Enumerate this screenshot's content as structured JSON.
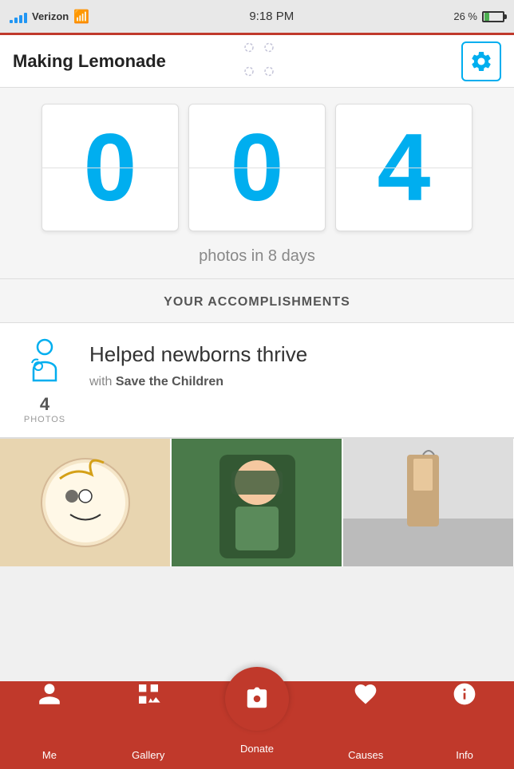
{
  "statusBar": {
    "carrier": "Verizon",
    "time": "9:18 PM",
    "battery": "26 %"
  },
  "header": {
    "title": "Making Lemonade",
    "settingsLabel": "Settings"
  },
  "counter": {
    "digits": [
      "0",
      "0",
      "4"
    ],
    "label": "photos in 8 days"
  },
  "accomplishments": {
    "heading": "YOUR ACCOMPLISHMENTS",
    "item": {
      "title": "Helped newborns thrive",
      "subtitle_prefix": "with ",
      "subtitle_org": "Save the Children",
      "photos_count": "4",
      "photos_label": "PHOTOS"
    }
  },
  "tabBar": {
    "tabs": [
      {
        "id": "me",
        "label": "Me"
      },
      {
        "id": "gallery",
        "label": "Gallery"
      },
      {
        "id": "donate",
        "label": "Donate"
      },
      {
        "id": "causes",
        "label": "Causes"
      },
      {
        "id": "info",
        "label": "Info"
      }
    ]
  }
}
